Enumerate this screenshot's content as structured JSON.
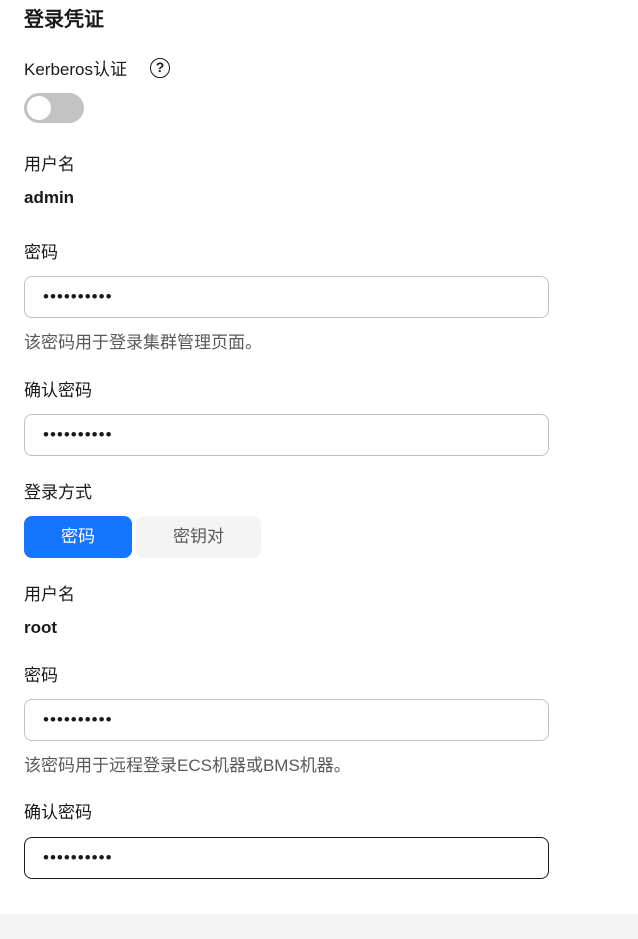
{
  "section": {
    "title": "登录凭证"
  },
  "kerberos": {
    "label": "Kerberos认证",
    "help_icon": "help-circle-icon",
    "help_glyph": "?",
    "enabled": false
  },
  "cluster_login": {
    "username_label": "用户名",
    "username_value": "admin",
    "password_label": "密码",
    "password_value": "••••••••••",
    "password_hint": "该密码用于登录集群管理页面。",
    "confirm_label": "确认密码",
    "confirm_value": "••••••••••"
  },
  "login_method": {
    "label": "登录方式",
    "options": [
      "密码",
      "密钥对"
    ],
    "selected": "密码"
  },
  "node_login": {
    "username_label": "用户名",
    "username_value": "root",
    "password_label": "密码",
    "password_value": "••••••••••",
    "password_hint": "该密码用于远程登录ECS机器或BMS机器。",
    "confirm_label": "确认密码",
    "confirm_value": "••••••••••"
  },
  "colors": {
    "primary": "#1476ff",
    "toggle_off": "#c2c2c2",
    "border": "#c2c2c2",
    "focused_border": "#191919",
    "hint_text": "#595959"
  }
}
